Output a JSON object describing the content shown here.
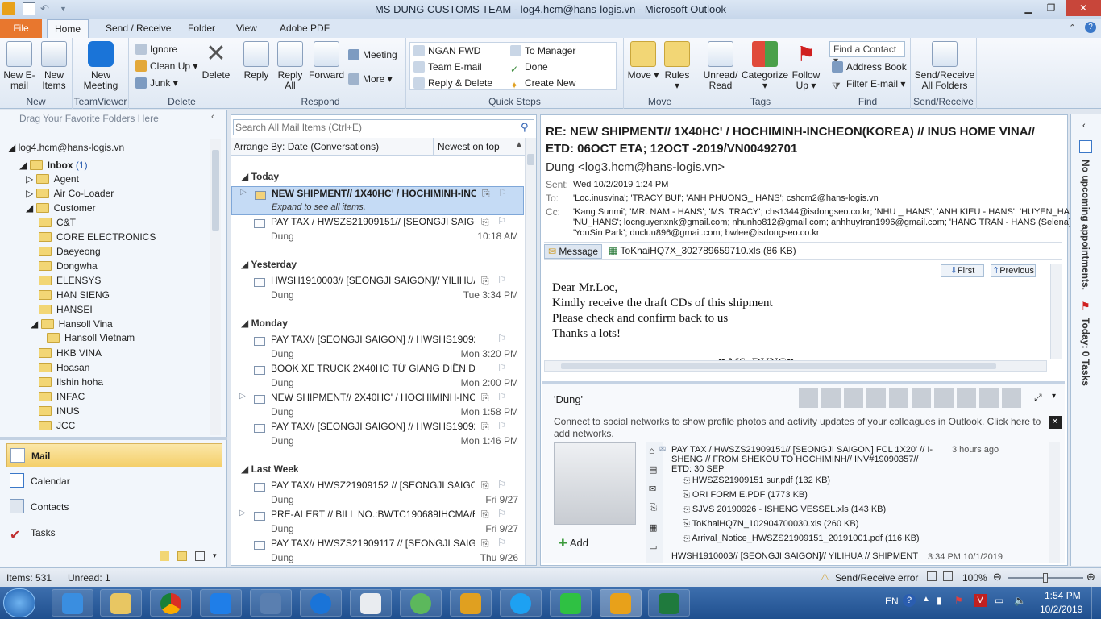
{
  "window": {
    "title": "MS DUNG CUSTOMS TEAM - log4.hcm@hans-logis.vn  -  Microsoft Outlook"
  },
  "tabs": [
    "File",
    "Home",
    "Send / Receive",
    "Folder",
    "View",
    "Adobe PDF"
  ],
  "ribbon": {
    "new": {
      "new_email": "New E-mail",
      "new_items": "New Items",
      "label": "New"
    },
    "teamviewer": {
      "new_meeting": "New Meeting",
      "label": "TeamViewer"
    },
    "delete": {
      "ignore": "Ignore",
      "cleanup": "Clean Up",
      "junk": "Junk",
      "delete": "Delete",
      "label": "Delete"
    },
    "respond": {
      "reply": "Reply",
      "reply_all": "Reply All",
      "forward": "Forward",
      "meeting": "Meeting",
      "more": "More",
      "label": "Respond"
    },
    "quicksteps": {
      "items": [
        "NGAN FWD",
        "To Manager",
        "Team E-mail",
        "Done",
        "Reply & Delete",
        "Create New"
      ],
      "label": "Quick Steps"
    },
    "move": {
      "move": "Move",
      "rules": "Rules",
      "label": "Move"
    },
    "tags": {
      "unread": "Unread/ Read",
      "categorize": "Categorize",
      "followup": "Follow Up",
      "label": "Tags"
    },
    "find": {
      "find_contact": "Find a Contact",
      "address_book": "Address Book",
      "filter": "Filter E-mail",
      "label": "Find"
    },
    "sendreceive": {
      "btn": "Send/Receive All Folders",
      "label": "Send/Receive"
    }
  },
  "nav": {
    "drag_hint": "Drag Your Favorite Folders Here",
    "account": "log4.hcm@hans-logis.vn",
    "inbox": "Inbox",
    "inbox_count": "(1)",
    "folders": [
      "Agent",
      "Air Co-Loader",
      "Customer",
      "C&T",
      "CORE ELECTRONICS",
      "Daeyeong",
      "Dongwha",
      "ELENSYS",
      "HAN SIENG",
      "HANSEI",
      "Hansoll Vina",
      "Hansoll Vietnam",
      "HKB VINA",
      "Hoasan",
      "Ilshin hoha",
      "INFAC",
      "INUS",
      "JCC"
    ],
    "buttons": [
      "Mail",
      "Calendar",
      "Contacts",
      "Tasks"
    ]
  },
  "list": {
    "search_placeholder": "Search All Mail Items (Ctrl+E)",
    "arrange": "Arrange By: Date (Conversations)",
    "order": "Newest on top",
    "groups": [
      "Today",
      "Yesterday",
      "Monday",
      "Last Week"
    ],
    "items": [
      {
        "subject": "NEW SHIPMENT// 1X40HC' / HOCHIMINH-INC...",
        "from": "Expand to see all items.",
        "date": ""
      },
      {
        "subject": "PAY TAX / HWSZS21909151// [SEONGJI SAIGON] ...",
        "from": "Dung",
        "date": "10:18 AM"
      },
      {
        "subject": "HWSH1910003//  [SEONGJI SAIGON]// YILIHUA // ...",
        "from": "Dung",
        "date": "Tue 3:34 PM"
      },
      {
        "subject": "PAY TAX// [SEONGJI SAIGON] // HWSHS1909248 /...",
        "from": "Dung",
        "date": "Mon 3:20 PM"
      },
      {
        "subject": "BOOK XE TRUCK 2X40HC TỪ GIANG ĐIỀN ĐI CÁT ...",
        "from": "Dung",
        "date": "Mon 2:00 PM"
      },
      {
        "subject": "NEW SHIPMENT// 2X40HC' / HOCHIMINH-INCHE...",
        "from": "Dung",
        "date": "Mon 1:58 PM"
      },
      {
        "subject": "PAY TAX// [SEONGJI SAIGON] // HWSHS1909248 /...",
        "from": "Dung",
        "date": "Mon 1:46 PM"
      },
      {
        "subject": "PAY TAX// HWSZ21909152 // [SEONGJI SAIGON] A...",
        "from": "Dung",
        "date": "Fri 9/27"
      },
      {
        "subject": "PRE-ALERT // BILL NO.:BWTC190689IHCMA/B // I...",
        "from": "Dung",
        "date": "Fri 9/27"
      },
      {
        "subject": "PAY TAX// HWSZS21909117 // [SEONGJI SAIGON] ...",
        "from": "Dung",
        "date": "Thu 9/26"
      }
    ]
  },
  "reading": {
    "subject": "RE: NEW SHIPMENT// 1X40HC' / HOCHIMINH-INCHEON(KOREA) // INUS HOME VINA// ETD: 06OCT ETA; 12OCT -2019/VN00492701",
    "sender": "Dung <log3.hcm@hans-logis.vn>",
    "sent_label": "Sent:",
    "sent": "Wed 10/2/2019 1:24 PM",
    "to_label": "To:",
    "to": "'Loc.inusvina'; 'TRACY BUI'; 'ANH PHUONG_ HANS'; cshcm2@hans-logis.vn",
    "cc_label": "Cc:",
    "cc1": "'Kang Sunmi'; 'MR. NAM - HANS'; 'MS. TRACY'; chs1344@isdongseo.co.kr; 'NHU _ HANS'; 'ANH KIEU - HANS'; 'HUYEN_HANS';",
    "cc2": "'NU_HANS'; locnguyenxnk@gmail.com; nhunho812@gmail.com; anhhuytran1996@gmail.com; 'HANG TRAN - HANS (Selena)';",
    "cc3": "'YouSin Park'; ducluu896@gmail.com; bwlee@isdongseo.co.kr",
    "message_tab": "Message",
    "attachment": "ToKhaiHQ7X_302789659710.xls (86 KB)",
    "first": "First",
    "previous": "Previous",
    "body": [
      "Dear Mr.Loc,",
      "Kindly receive the draft CDs of this shipment",
      "Please check and confirm back to us",
      "Thanks a lots!"
    ],
    "signature": "♥ MS. DUNG♥"
  },
  "people": {
    "name": "'Dung'",
    "connect": "Connect to social networks to show profile photos and activity updates of your colleagues in Outlook. Click here to add networks.",
    "add": "Add",
    "item1_subject": "PAY TAX / HWSZS21909151// [SEONGJI SAIGON] FCL 1X20' // I-SHENG // FROM SHEKOU TO HOCHIMINH// INV#19090357// ETD: 30 SEP",
    "item1_time": "3 hours ago",
    "attachments": [
      "HWSZS21909151 sur.pdf (132 KB)",
      "ORI FORM E.PDF (1773 KB)",
      "SJVS 20190926 - ISHENG VESSEL.xls (143 KB)",
      "ToKhaiHQ7N_102904700030.xls (260 KB)",
      "Arrival_Notice_HWSZS21909151_20191001.pdf (116 KB)"
    ],
    "item2_subject": "HWSH1910003// [SEONGJI SAIGON]// YILIHUA // SHIPMENT",
    "item2_time": "3:34 PM 10/1/2019"
  },
  "todo": {
    "appointments": "No upcoming appointments.",
    "tasks": "Today: 0 Tasks"
  },
  "status": {
    "items": "Items: 531",
    "unread": "Unread: 1",
    "error": "Send/Receive error",
    "zoom": "100%"
  },
  "taskbar": {
    "lang": "EN",
    "time": "1:54 PM",
    "date": "10/2/2019"
  }
}
